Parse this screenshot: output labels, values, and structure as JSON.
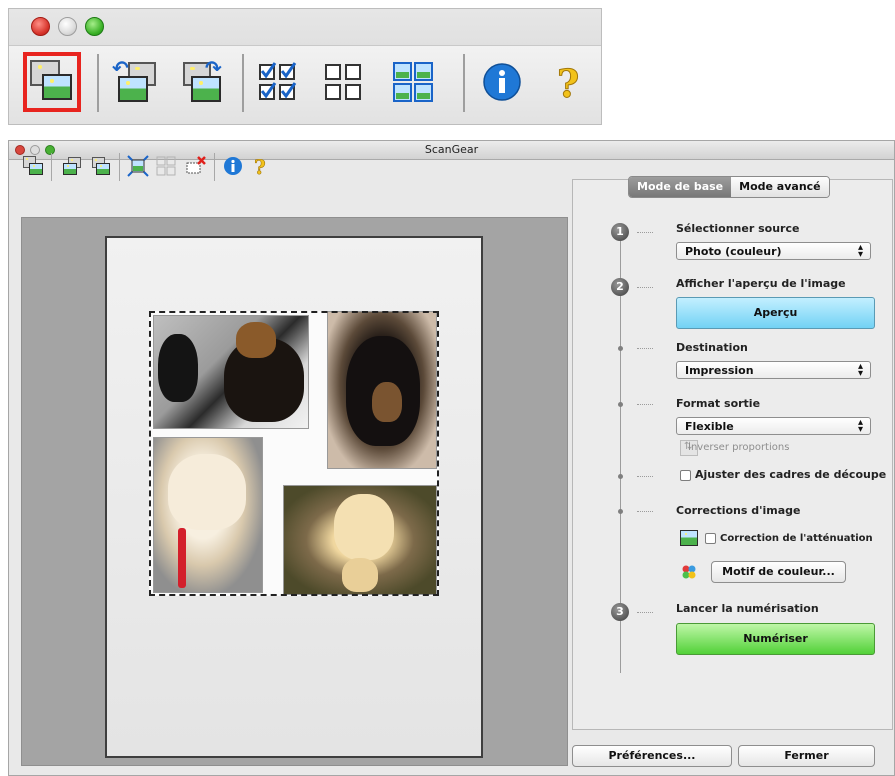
{
  "zoom_toolbar": {
    "tools": [
      {
        "icon": "scan-preview-icon"
      },
      {
        "icon": "rotate-left-icon"
      },
      {
        "icon": "rotate-right-icon"
      },
      {
        "icon": "select-all-frames-icon"
      },
      {
        "icon": "deselect-frames-icon"
      },
      {
        "icon": "multi-crop-icon"
      },
      {
        "icon": "info-icon"
      },
      {
        "icon": "help-icon"
      }
    ],
    "selected_index": 0,
    "highlight_color": "#e8241f"
  },
  "window": {
    "title": "ScanGear"
  },
  "tabs": {
    "basic": "Mode de base",
    "advanced": "Mode avancé",
    "active": "basic"
  },
  "steps": {
    "step1": {
      "number": "1",
      "label": "Sélectionner source",
      "select_value": "Photo (couleur)"
    },
    "step2": {
      "number": "2",
      "label": "Afficher l'aperçu de l'image",
      "button": "Aperçu"
    },
    "destination": {
      "label": "Destination",
      "select_value": "Impression"
    },
    "output_size": {
      "label": "Format sortie",
      "select_value": "Flexible",
      "invert_label": "Inverser proportions"
    },
    "crop": {
      "label": "Ajuster des cadres de découpe"
    },
    "corrections": {
      "label": "Corrections d'image",
      "fading_label": "Correction de l'atténuation",
      "color_pattern_button": "Motif de couleur..."
    },
    "step3": {
      "number": "3",
      "label": "Lancer la numérisation",
      "button": "Numériser"
    }
  },
  "footer": {
    "preferences": "Préférences...",
    "close": "Fermer"
  },
  "colors": {
    "preview_button": "#72d2f4",
    "scan_button": "#52d138"
  }
}
